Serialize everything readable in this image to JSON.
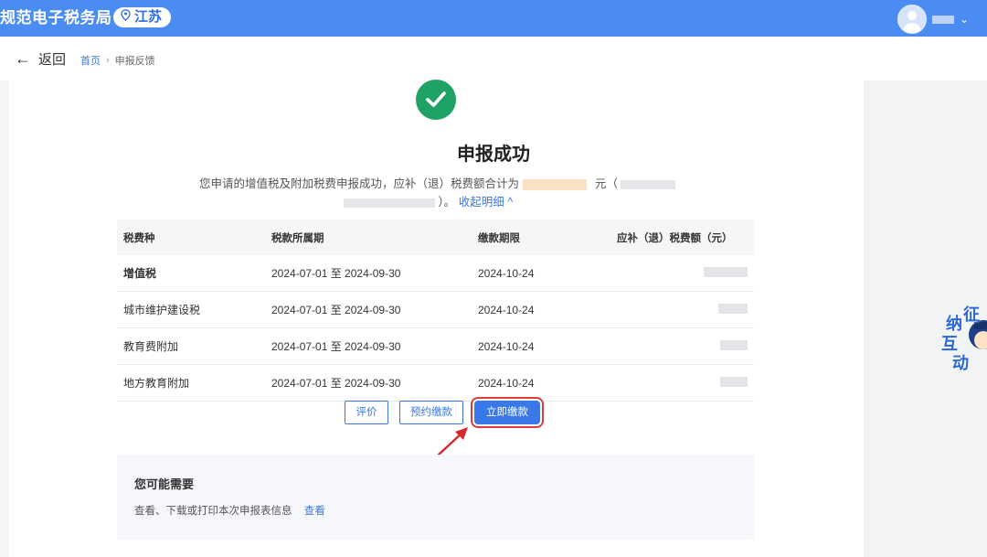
{
  "header": {
    "brand": "规范电子税务局",
    "region": "江苏"
  },
  "nav": {
    "back_label": "返回",
    "breadcrumb": {
      "home": "首页",
      "separator": "›",
      "current": "申报反馈"
    }
  },
  "result": {
    "title": "申报成功",
    "desc_prefix": "您申请的增值税及附加税费申报成功，应补（退）税费额合计为",
    "unit": "元（",
    "desc_suffix": "）。",
    "toggle": "收起明细",
    "toggle_icon": "^"
  },
  "table": {
    "headers": [
      "税费种",
      "税款所属期",
      "缴款期限",
      "应补（退）税费额（元）"
    ],
    "rows": [
      {
        "name": "增值税",
        "period": "2024-07-01 至 2024-09-30",
        "deadline": "2024-10-24"
      },
      {
        "name": "城市维护建设税",
        "period": "2024-07-01 至 2024-09-30",
        "deadline": "2024-10-24"
      },
      {
        "name": "教育费附加",
        "period": "2024-07-01 至 2024-09-30",
        "deadline": "2024-10-24"
      },
      {
        "name": "地方教育附加",
        "period": "2024-07-01 至 2024-09-30",
        "deadline": "2024-10-24"
      }
    ]
  },
  "actions": {
    "evaluate": "评价",
    "schedule_pay": "预约缴款",
    "pay_now": "立即缴款"
  },
  "hint": {
    "title": "您可能需要",
    "text": "查看、下载或打印本次申报表信息",
    "link": "查看"
  },
  "mascot": {
    "chars": [
      "征",
      "纳",
      "互",
      "动"
    ]
  },
  "colors": {
    "topbar": "#4a8cf1",
    "accent": "#3a78e8",
    "success": "#1fa365",
    "highlight": "#e03a3a"
  }
}
